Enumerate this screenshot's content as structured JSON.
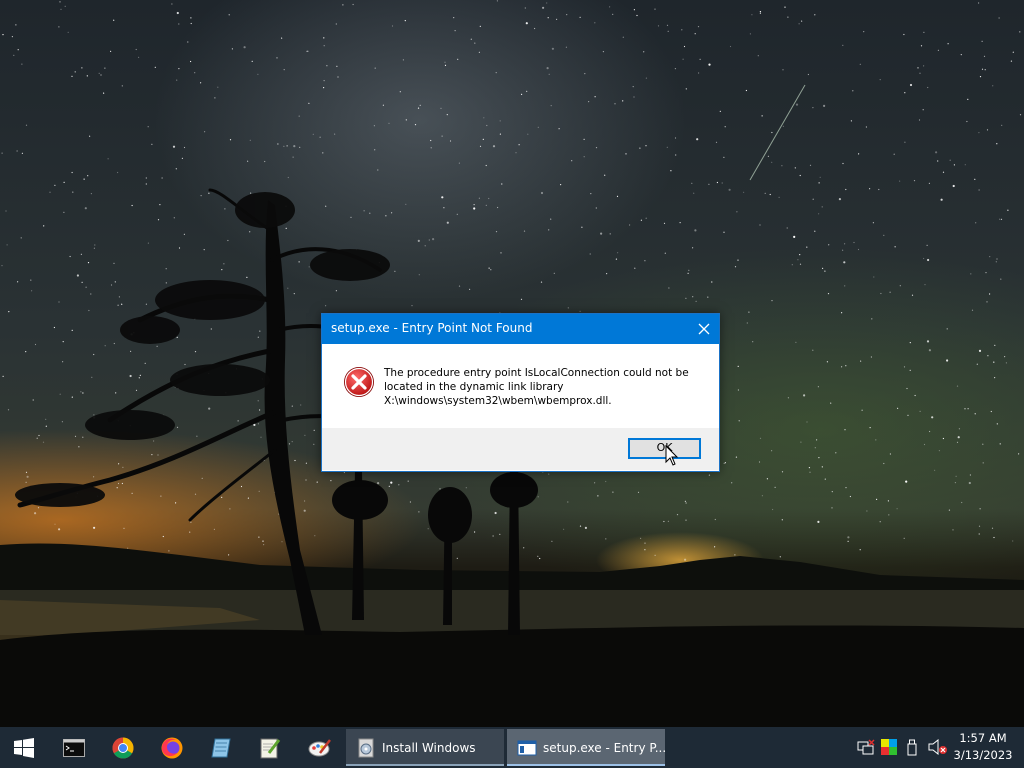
{
  "desktop": {
    "wallpaper": "night-sky-lake-trees"
  },
  "dialog": {
    "title": "setup.exe - Entry Point Not Found",
    "close_icon": "close-icon",
    "icon": "error-icon",
    "message": "The procedure entry point IsLocalConnection could not be located in the dynamic link library X:\\windows\\system32\\wbem\\wbemprox.dll.",
    "ok_label": "OK",
    "accent_color": "#0078d7"
  },
  "taskbar": {
    "start_icon": "windows-logo-icon",
    "pinned": [
      "command-prompt-icon",
      "chrome-icon",
      "firefox-icon",
      "notepad-icon",
      "notepadplusplus-icon",
      "paint-icon"
    ],
    "tasks": [
      {
        "label": "Install Windows",
        "icon": "setup-disc-icon"
      },
      {
        "label": "setup.exe - Entry P...",
        "icon": "window-icon"
      }
    ],
    "tray": [
      "network-icon",
      "color-icon",
      "usb-icon",
      "volume-muted-icon"
    ],
    "clock": {
      "time": "1:57 AM",
      "date": "3/13/2023"
    }
  }
}
